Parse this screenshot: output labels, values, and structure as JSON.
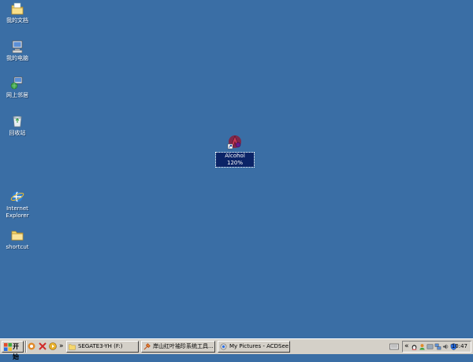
{
  "desktop": {
    "icons": [
      {
        "label": "我的文档",
        "icon": "my-documents-icon"
      },
      {
        "label": "我的电脑",
        "icon": "my-computer-icon"
      },
      {
        "label": "网上邻居",
        "icon": "network-places-icon"
      },
      {
        "label": "回收站",
        "icon": "recycle-bin-icon"
      },
      {
        "label": "Internet\nExplorer",
        "icon": "internet-explorer-icon"
      },
      {
        "label": "shortcut",
        "icon": "folder-icon"
      },
      {
        "label": "Alcohol 120%",
        "icon": "alcohol-120-icon"
      }
    ],
    "background_color": "#3a6ea5"
  },
  "taskbar": {
    "start_label": "开始",
    "quick_launch": [
      "browser-icon",
      "app-x-icon",
      "media-icon"
    ],
    "overflow_label": "»",
    "tasks": [
      {
        "label": "SEGATE3-YH (F:)",
        "icon": "folder-icon"
      },
      {
        "label": "岸山红叶袖珍系统工具...",
        "icon": "tool-icon"
      },
      {
        "label": "My Pictures - ACDSee Pr...",
        "icon": "acdsee-icon"
      }
    ],
    "tray_chevron": "«",
    "clock": "10:47"
  }
}
